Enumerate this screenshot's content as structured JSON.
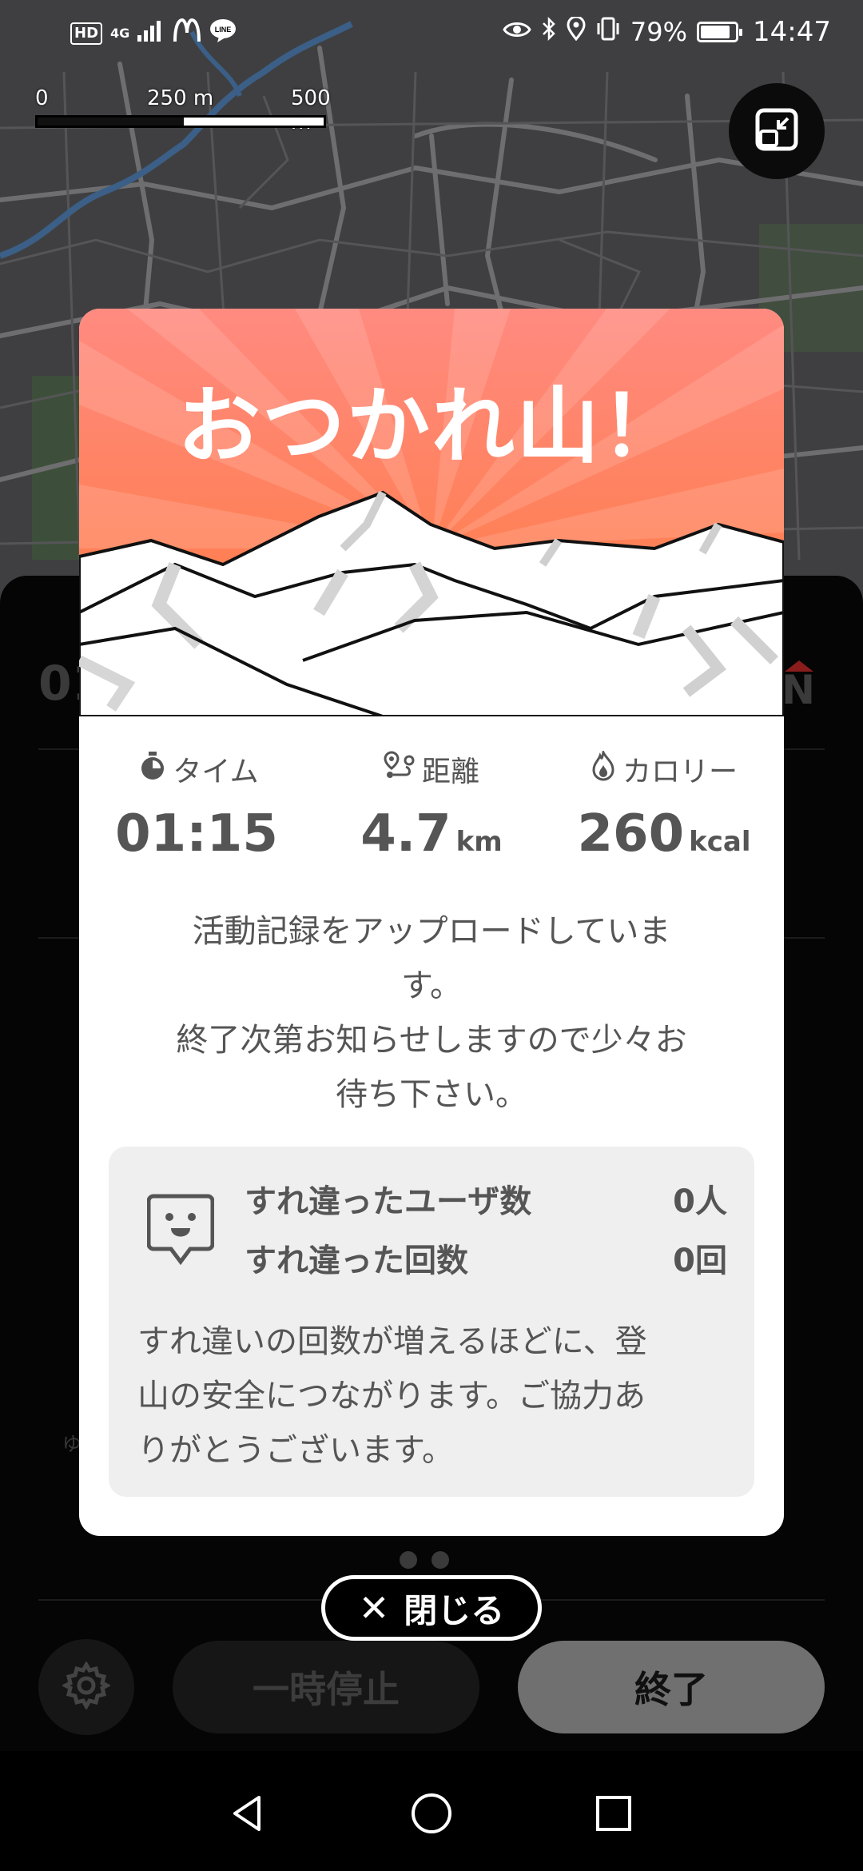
{
  "status_bar": {
    "hd": "HD",
    "network": "4G",
    "battery_percent": "79%",
    "battery_level": 0.79,
    "time": "14:47",
    "icons": [
      "signal-icon",
      "mcdonalds-app-icon",
      "line-app-icon",
      "eye-icon",
      "bluetooth-icon",
      "location-icon",
      "vibrate-icon",
      "battery-icon"
    ]
  },
  "map": {
    "scale_labels": [
      "0",
      "250 m",
      "500 m"
    ],
    "toggle_icon": "map-resize-icon"
  },
  "background_panel": {
    "time_partial": "01",
    "letter_partial": "N",
    "hint_partial": "ゆ"
  },
  "modal": {
    "title": "おつかれ山！",
    "stats": [
      {
        "icon": "timer-icon",
        "label": "タイム",
        "value": "01:15",
        "unit": ""
      },
      {
        "icon": "route-icon",
        "label": "距離",
        "value": "4.7",
        "unit": "km"
      },
      {
        "icon": "flame-icon",
        "label": "カロリー",
        "value": "260",
        "unit": "kcal"
      }
    ],
    "upload_message_line1": "活動記録をアップロードしていま",
    "upload_message_line2": "す。",
    "upload_message_line3": "終了次第お知らせしますので少々お",
    "upload_message_line4": "待ち下さい。",
    "encounter": {
      "icon": "encounter-face-icon",
      "users_label": "すれ違ったユーザ数",
      "users_value": "0人",
      "count_label": "すれ違った回数",
      "count_value": "0回",
      "note_line1": "すれ違いの回数が増えるほどに、登",
      "note_line2": "山の安全につながります。ご協力あ",
      "note_line3": "りがとうございます。"
    }
  },
  "close_button": {
    "label": "閉じる",
    "icon": "close-icon"
  },
  "controls": {
    "settings_icon": "gear-icon",
    "pause_label": "一時停止",
    "finish_label": "終了"
  },
  "nav_bar": {
    "back_icon": "back-icon",
    "home_icon": "home-icon",
    "recents_icon": "recents-icon"
  },
  "colors": {
    "hero_top": "#ff8a80",
    "hero_bottom": "#ff7a3a",
    "text_gray": "#555555",
    "panel_bg": "#050505"
  }
}
